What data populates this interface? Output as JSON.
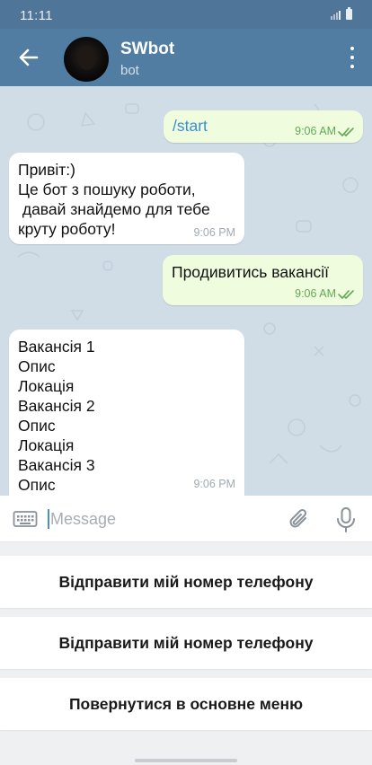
{
  "status_bar": {
    "time": "11:11"
  },
  "header": {
    "title": "SWbot",
    "subtitle": "bot"
  },
  "messages": [
    {
      "direction": "outgoing",
      "text": "/start",
      "time": "9:06 AM",
      "is_command": true
    },
    {
      "direction": "incoming",
      "text": "Привіт:)\nЦе бот з пошуку роботи,\n давай знайдемо для тебе\nкруту роботу!",
      "time": "9:06 PM"
    },
    {
      "direction": "outgoing",
      "text": "Продивитись вакансії",
      "time": "9:06 AM"
    },
    {
      "direction": "incoming",
      "text": "Вакансія 1\nОпис\nЛокація\nВакансія 2\nОпис\nЛокація\nВакансія 3\nОпис",
      "time": "9:06 PM"
    }
  ],
  "input": {
    "placeholder": "Message"
  },
  "keyboard_buttons": [
    "Відправити мій номер телефону",
    "Відправити мій номер телефону",
    "Повернутися в основне меню"
  ],
  "colors": {
    "header": "#517da2",
    "chat_background": "#d1dde6",
    "outgoing_bubble": "#effdde",
    "incoming_bubble": "#ffffff",
    "accent": "#3a8fd1"
  },
  "icons": {
    "back": "arrow-left-icon",
    "menu": "more-vertical-icon",
    "keyboard": "keyboard-icon",
    "attach": "paperclip-icon",
    "voice": "microphone-icon",
    "read": "double-check-icon"
  }
}
